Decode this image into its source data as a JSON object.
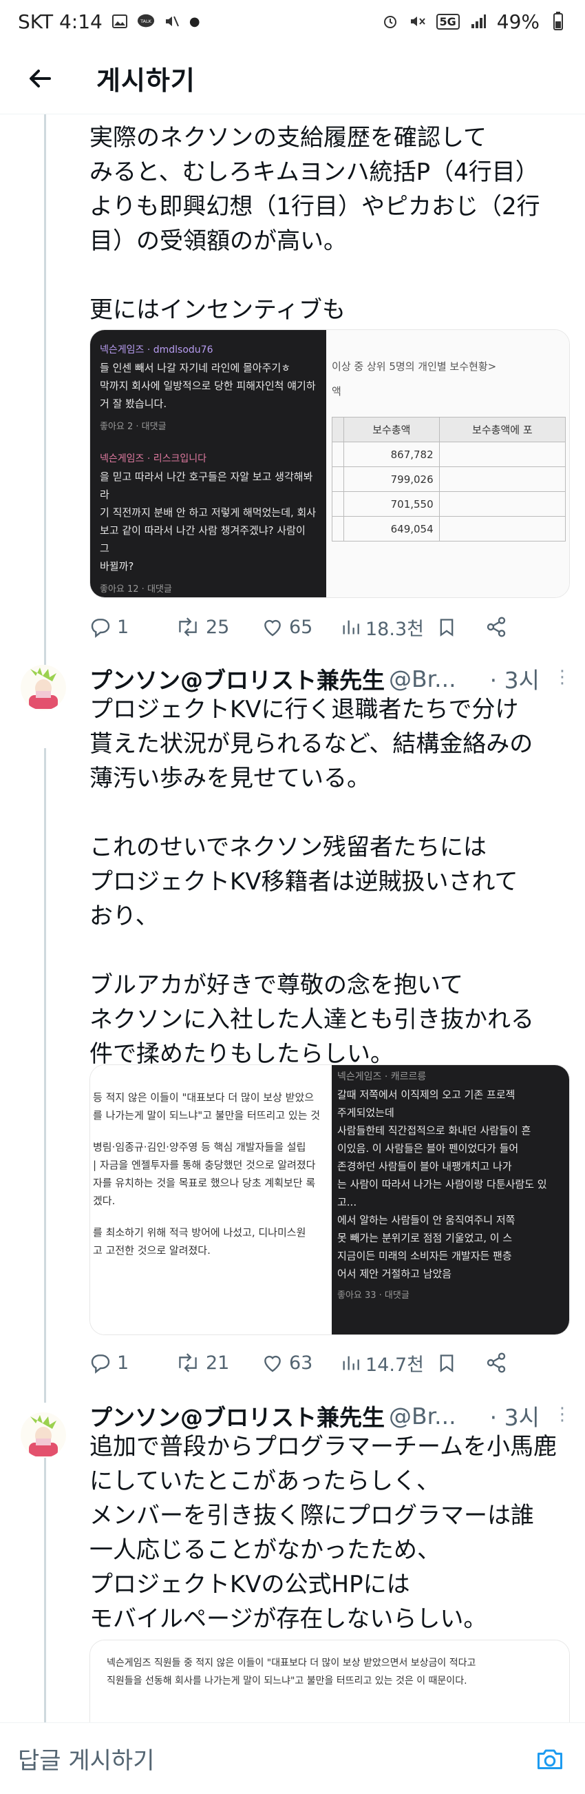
{
  "status_bar": {
    "carrier_time": "SKT 4:14",
    "talk_badge": "TALK",
    "battery": "49%",
    "network": "5G"
  },
  "header": {
    "title": "게시하기"
  },
  "tweet1": {
    "text": "実際のネクソンの支給履歴を確認して\nみると、むしろキムヨンハ統括P（4行目）\nよりも即興幻想（1行目）やピカおじ（2行\n目）の受領額のが高い。\n\n更にはインセンティブも",
    "media_left": {
      "c1_user": "넥슨게임즈 · dmdlsodu76",
      "c1_lines": [
        "들 인센 빼서 나갈 자기네 라인에 몰아주기ㅎ",
        "막까지 회사에 일방적으로 당한 피해자인척 얘기하",
        "거 잘 봤습니다."
      ],
      "c1_meta": "좋아요 2 · 대댓글",
      "c2_user": "넥슨게임즈 · 리스크입니다",
      "c2_lines": [
        "을 믿고 따라서 나간 호구들은 자알 보고 생각해봐라",
        "기 직전까지 분배 안 하고 저렇게 해먹었는데, 회사",
        "보고 같이 따라서 나간 사람 챙겨주겠냐? 사람이 그",
        "바뀔까?"
      ],
      "c2_meta": "좋아요 12 · 대댓글"
    },
    "media_right": {
      "caption": "이상 중 상위 5명의 개인별 보수현황>",
      "caption2": "액",
      "col1": "보수총액",
      "col2": "보수총액에 포",
      "rows": [
        "867,782",
        "799,026",
        "701,550",
        "649,054"
      ]
    },
    "stats": {
      "replies": "1",
      "retweets": "25",
      "likes": "65",
      "views": "18.3천"
    }
  },
  "tweet2": {
    "name": "プンソン@ブロリスト兼先生",
    "handle": "@Br...",
    "time": "· 3시",
    "text": "プロジェクトKVに行く退職者たちで分け\n貰えた状況が見られるなど、結構金絡みの\n薄汚い歩みを見せている。\n\nこれのせいでネクソン残留者たちには\nプロジェクトKV移籍者は逆賊扱いされて\nおり、\n\nブルアカが好きで尊敬の念を抱いて\nネクソンに入社した人達とも引き抜かれる\n件で揉めたりもしたらしい。",
    "media_left_lines": [
      "등 적지 않은 이들이 \"대표보다 더 많이 보상 받았으",
      "를 나가는게 말이 되느냐\"고 불만을 터뜨리고 있는 것",
      "",
      "병림·임종규·김인·양주영 등 핵심 개발자들을 설립",
      "| 자금을 엔젤투자를 통해 충당했던 것으로 알려졌다",
      "자를 유치하는 것을 목표로 했으나 당초 계획보단 록",
      "겠다.",
      "",
      "를 최소하기 위해 적극 방어에 나섰고, 디나미스원",
      "고 고전한 것으로 알려졌다."
    ],
    "media_right": {
      "user": "넥슨게임즈 · 캐르르릉",
      "lines": [
        "갈때 저쪽에서 이직제의 오고 기존 프로젝",
        "주게되었는데",
        "사람들한테 직간접적으로 화내던 사람들이 흔",
        "이있음. 이 사람들은 블아 펜이었다가 들어",
        "존경하던 사람들이 블아 내팽개치고 나가",
        "는 사람이 따라서 나가는 사람이랑 다툰사람도 있고...",
        "에서 알하는 사람들이 안 움직여주니 저쪽",
        "못 빼가는 분위기로 점점 기울었고, 이 스",
        "지금이든 미래의 소비자든 개발자든 팬층",
        "어서 제안 거절하고 남았음"
      ],
      "meta": "좋아요 33 · 대댓글"
    },
    "stats": {
      "replies": "1",
      "retweets": "21",
      "likes": "63",
      "views": "14.7천"
    }
  },
  "tweet3": {
    "name": "プンソン@ブロリスト兼先生",
    "handle": "@Br...",
    "time": "· 3시",
    "text": "追加で普段からプログラマーチームを小馬鹿\nにしていたとこがあったらしく、\nメンバーを引き抜く際にプログラマーは誰\n一人応じることがなかったため、\nプロジェクトKVの公式HPには\nモバイルページが存在しないらしい。",
    "media_lines": [
      "넥슨게임즈 직원들 중 적지 않은 이들이 \"대표보다 더 많이 보상 받았으면서 보상금이 적다고",
      "직원들을 선동해 회사를 나가는게 말이 되느냐\"고 불만을 터뜨리고 있는 것은 이 때문이다."
    ]
  },
  "reply_bar": {
    "label": "답글 게시하기"
  },
  "colors": {
    "accent": "#1d9bf0",
    "muted": "#536471",
    "text": "#0f1419"
  }
}
